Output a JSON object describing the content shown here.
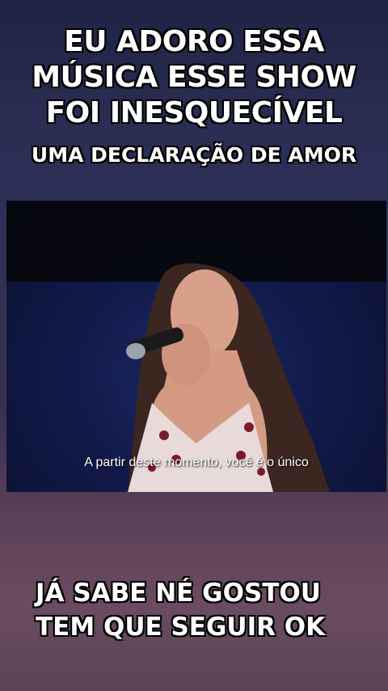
{
  "overlay": {
    "headline": "EU ADORO ESSA MÚSICA ESSE SHOW FOI INESQUECÍVEL",
    "subheadline": "UMA DECLARAÇÃO DE AMOR",
    "footer": "JÁ SABE NÉ GOSTOU TEM QUE SEGUIR OK"
  },
  "video": {
    "subtitle": "A partir deste momento, você é o único"
  }
}
